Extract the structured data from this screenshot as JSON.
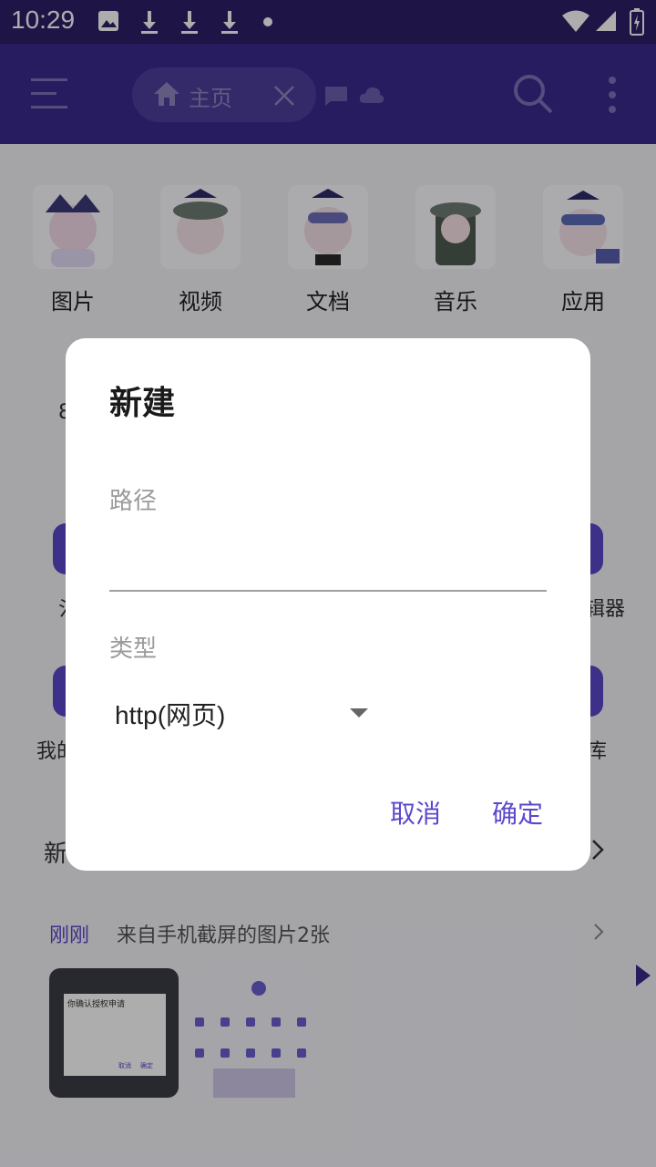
{
  "status_bar": {
    "time": "10:29"
  },
  "toolbar": {
    "tab_label": "主页",
    "icons": [
      "menu-icon",
      "home-icon",
      "close-icon",
      "message-icon",
      "cloud-icon",
      "search-icon",
      "more-vert-icon"
    ]
  },
  "categories": [
    {
      "label": "图片"
    },
    {
      "label": "视频"
    },
    {
      "label": "文档"
    },
    {
      "label": "音乐"
    },
    {
      "label": "应用"
    }
  ],
  "background_fragments": {
    "editor": "辑器",
    "library": "库",
    "mine": "我的",
    "new": "新",
    "digit": "8",
    "water": "氵"
  },
  "recent": {
    "time_label": "刚刚",
    "description": "来自手机截屏的图片2张",
    "thumb_text": [
      "你确认授权申请",
      "取消",
      "确定"
    ]
  },
  "dialog": {
    "title": "新建",
    "path_label": "路径",
    "path_value": "",
    "type_label": "类型",
    "type_value": "http(网页)",
    "cancel_label": "取消",
    "confirm_label": "确定"
  },
  "colors": {
    "status_bar": "#2d2068",
    "toolbar": "#3a2a8c",
    "accent": "#5a48cc"
  }
}
